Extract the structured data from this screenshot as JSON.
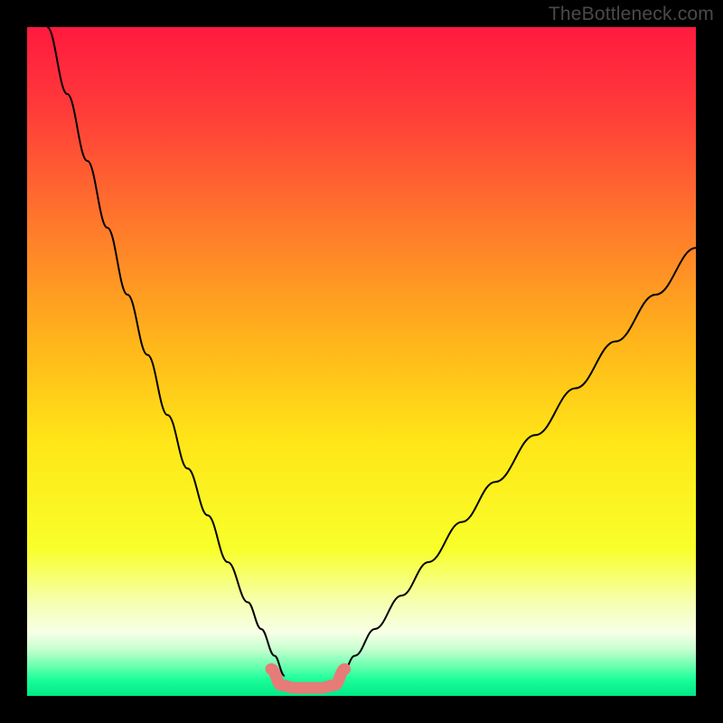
{
  "watermark": "TheBottleneck.com",
  "chart_data": {
    "type": "line",
    "title": "",
    "xlabel": "",
    "ylabel": "",
    "xlim": [
      0,
      100
    ],
    "ylim": [
      0,
      100
    ],
    "background_gradient_stops": [
      {
        "offset": 0.0,
        "color": "#ff1a3f"
      },
      {
        "offset": 0.12,
        "color": "#ff3a3a"
      },
      {
        "offset": 0.3,
        "color": "#ff7a2b"
      },
      {
        "offset": 0.48,
        "color": "#ffb81a"
      },
      {
        "offset": 0.62,
        "color": "#ffe618"
      },
      {
        "offset": 0.78,
        "color": "#f8ff2a"
      },
      {
        "offset": 0.86,
        "color": "#f6ffb0"
      },
      {
        "offset": 0.905,
        "color": "#f7ffe6"
      },
      {
        "offset": 0.93,
        "color": "#c7ffd0"
      },
      {
        "offset": 0.955,
        "color": "#6cffb0"
      },
      {
        "offset": 0.975,
        "color": "#1cff9a"
      },
      {
        "offset": 1.0,
        "color": "#00e886"
      }
    ],
    "series": [
      {
        "name": "bottleneck-curve-left",
        "color": "#000000",
        "width": 2,
        "x": [
          3,
          6,
          9,
          12,
          15,
          18,
          21,
          24,
          27,
          30,
          33,
          35,
          37,
          38.5
        ],
        "y": [
          100,
          90,
          80,
          70,
          60,
          51,
          42,
          34,
          27,
          20,
          14,
          10,
          6,
          3
        ]
      },
      {
        "name": "bottleneck-curve-right",
        "color": "#000000",
        "width": 2,
        "x": [
          47,
          49,
          52,
          56,
          60,
          65,
          70,
          76,
          82,
          88,
          94,
          100
        ],
        "y": [
          3,
          6,
          10,
          15,
          20,
          26,
          32,
          39,
          46,
          53,
          60,
          67
        ]
      },
      {
        "name": "optimal-band",
        "color": "#e77b78",
        "width": 13,
        "cap": "round",
        "x": [
          36.5,
          38,
          40,
          42,
          44,
          46,
          47.5
        ],
        "y": [
          4.0,
          1.6,
          1.2,
          1.2,
          1.2,
          1.6,
          4.0
        ]
      }
    ]
  }
}
